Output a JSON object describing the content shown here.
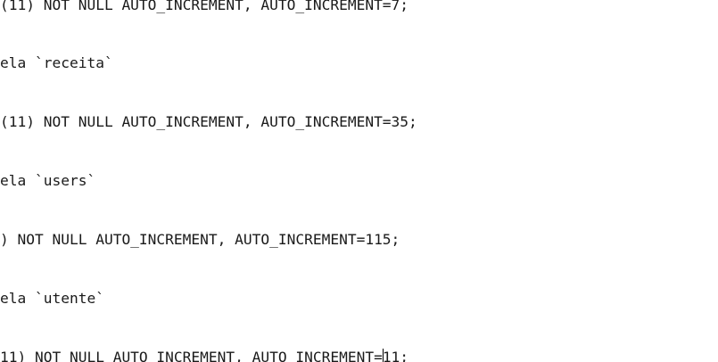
{
  "editor": {
    "lines": [
      "(11) NOT NULL AUTO_INCREMENT, AUTO_INCREMENT=7;",
      "ela `receita`",
      "(11) NOT NULL AUTO_INCREMENT, AUTO_INCREMENT=35;",
      "ela `users`",
      ") NOT NULL AUTO_INCREMENT, AUTO_INCREMENT=115;",
      "ela `utente`"
    ],
    "last_line_before_caret": "11) NOT NULL AUTO_INCREMENT, AUTO_INCREMENT=",
    "last_line_after_caret": "11;"
  }
}
